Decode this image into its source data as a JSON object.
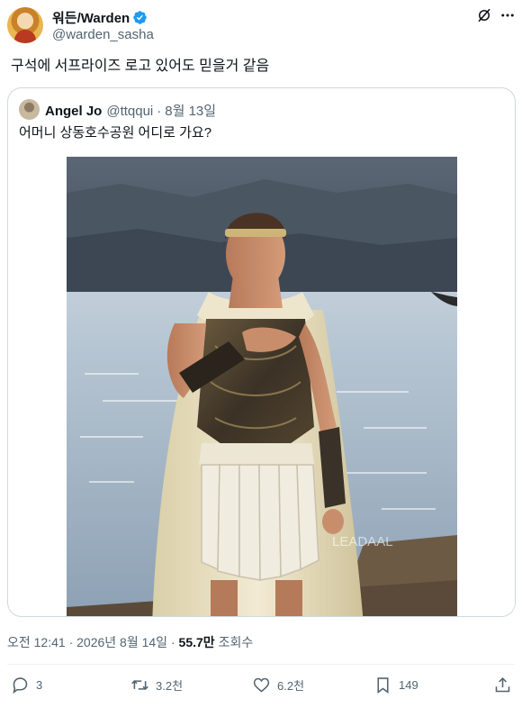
{
  "author": {
    "display_name": "워든/Warden",
    "handle": "@warden_sasha"
  },
  "tweet": {
    "text": "구석에 서프라이즈 로고 있어도 믿을거 같음"
  },
  "quoted_tweet": {
    "display_name": "Angel Jo",
    "handle": "@ttqqui",
    "separator": "·",
    "date": "8월 13일",
    "text": "어머니 상동호수공원 어디로 가요?",
    "image_watermark": "LEADAAL"
  },
  "meta": {
    "time": "오전 12:41",
    "separator": "·",
    "date": "2026년 8월 14일",
    "separator2": "·",
    "views": "55.7만",
    "views_label": "조회수"
  },
  "actions": {
    "replies": "3",
    "retweets": "3.2천",
    "likes": "6.2천",
    "bookmarks": "149"
  },
  "colors": {
    "verified": "#1d9bf0",
    "text_primary": "#0f1419",
    "text_secondary": "#536471",
    "border": "#cfd9de"
  }
}
